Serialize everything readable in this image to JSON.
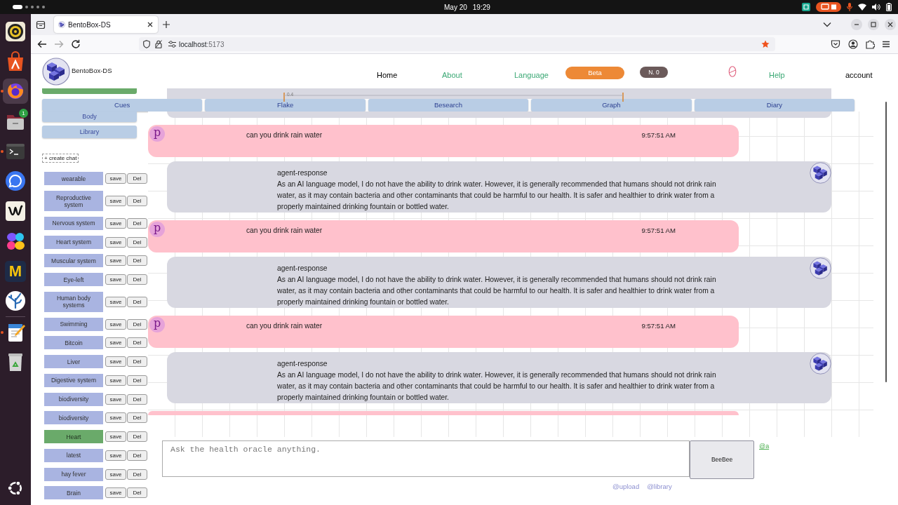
{
  "system_bar": {
    "date": "May 20",
    "time": "19:29"
  },
  "dock": [
    {
      "kind": "speaker",
      "running": false,
      "focused": false
    },
    {
      "kind": "bag",
      "running": false,
      "focused": false
    },
    {
      "kind": "browser",
      "running": true,
      "focused": true
    },
    {
      "kind": "folder",
      "running": false,
      "focused": false,
      "badge": "1"
    },
    {
      "kind": "terminal",
      "running": true,
      "focused": false
    },
    {
      "kind": "chat",
      "running": false,
      "focused": false
    },
    {
      "kind": "zigzag",
      "running": false,
      "focused": false
    },
    {
      "kind": "petals",
      "running": false,
      "focused": false
    },
    {
      "kind": "letter",
      "glyph": "M",
      "running": false,
      "focused": false
    },
    {
      "kind": "coral",
      "running": false,
      "focused": false
    },
    {
      "kind": "separator"
    },
    {
      "kind": "notepad",
      "running": true,
      "focused": false
    },
    {
      "kind": "trash",
      "running": false,
      "focused": false
    }
  ],
  "browser": {
    "tab_title": "BentoBox-DS",
    "url_host": "localhost",
    "url_port": ":5173",
    "bookmarked": true
  },
  "header": {
    "brand": "BentoBox-DS",
    "nav": [
      {
        "kind": "link",
        "label": "Home",
        "color": "#000000"
      },
      {
        "kind": "link",
        "label": "About",
        "color": "#3aa874"
      },
      {
        "kind": "link",
        "label": "Language",
        "color": "#3aa874"
      },
      {
        "kind": "button",
        "label": "Beta",
        "color": "#ed8936"
      },
      {
        "kind": "counter",
        "label": "N. 0",
        "color": "#6b5a5a"
      },
      {
        "kind": "icon"
      },
      {
        "kind": "link",
        "label": "Help",
        "color": "#3aa874"
      },
      {
        "kind": "link",
        "label": "account",
        "color": "#000000"
      }
    ]
  },
  "sidebar": {
    "buttons": [
      {
        "selected": true
      },
      {
        "label": "Body",
        "selected": false
      },
      {
        "label": "Library",
        "selected": false
      }
    ],
    "create_chat": "+ create chat",
    "chats": [
      {
        "title": "wearable",
        "selected": false,
        "save": "save",
        "delete": "Del"
      },
      {
        "title": "Reproductive system",
        "selected": false,
        "save": "save",
        "delete": "Del"
      },
      {
        "title": "Nervous system",
        "selected": false,
        "save": "save",
        "delete": "Del"
      },
      {
        "title": "Heart system",
        "selected": false,
        "save": "save",
        "delete": "Del"
      },
      {
        "title": "Muscular system",
        "selected": false,
        "save": "save",
        "delete": "Del"
      },
      {
        "title": "Eye-left",
        "selected": false,
        "save": "save",
        "delete": "Del"
      },
      {
        "title": "Human body systems",
        "selected": false,
        "save": "save",
        "delete": "Del"
      },
      {
        "title": "Swimming",
        "selected": false,
        "save": "save",
        "delete": "Del"
      },
      {
        "title": "Bitcoin",
        "selected": false,
        "save": "save",
        "delete": "Del"
      },
      {
        "title": "Liver",
        "selected": false,
        "save": "save",
        "delete": "Del"
      },
      {
        "title": "Digestive system",
        "selected": false,
        "save": "save",
        "delete": "Del"
      },
      {
        "title": "biodiversity",
        "selected": false,
        "save": "save",
        "delete": "Del"
      },
      {
        "title": "biodiversity",
        "selected": false,
        "save": "save",
        "delete": "Del"
      },
      {
        "title": "Heart",
        "selected": true,
        "save": "save",
        "delete": "Del"
      },
      {
        "title": "latest",
        "selected": false,
        "save": "save",
        "delete": "Del"
      },
      {
        "title": "hay fever",
        "selected": false,
        "save": "save",
        "delete": "Del"
      },
      {
        "title": "Brain",
        "selected": false,
        "save": "save",
        "delete": "Del"
      }
    ]
  },
  "scale": {
    "reading": "0.4"
  },
  "tabs": [
    {
      "label": "Cues",
      "selected": false
    },
    {
      "label": "Flake",
      "selected": false
    },
    {
      "label": "Besearch",
      "selected": false
    },
    {
      "label": "Graph",
      "selected": false
    },
    {
      "label": "Diary",
      "selected": false
    }
  ],
  "messages": [
    {
      "kind": "user",
      "avatar": "p",
      "text": "can you drink rain water",
      "time": "9:57:51 AM"
    },
    {
      "kind": "agent",
      "label": "agent-response",
      "text": "As an AI language model, I do not have the ability to drink water. However, it is generally recommended that humans should not drink rain water, as it may contain bacteria and other contaminants that could be harmful to our health. It is safer and healthier to drink water from a properly maintained drinking fountain or bottled water."
    },
    {
      "kind": "user",
      "avatar": "p",
      "text": "can you drink rain water",
      "time": "9:57:51 AM"
    },
    {
      "kind": "agent",
      "label": "agent-response",
      "text": "As an AI language model, I do not have the ability to drink water. However, it is generally recommended that humans should not drink rain water, as it may contain bacteria and other contaminants that could be harmful to our health. It is safer and healthier to drink water from a properly maintained drinking fountain or bottled water."
    },
    {
      "kind": "user",
      "avatar": "p",
      "text": "can you drink rain water",
      "time": "9:57:51 AM"
    },
    {
      "kind": "agent",
      "label": "agent-response",
      "text": "As an AI language model, I do not have the ability to drink water. However, it is generally recommended that humans should not drink rain water, as it may contain bacteria and other contaminants that could be harmful to our health. It is safer and healthier to drink water from a properly maintained drinking fountain or bottled water."
    },
    {
      "kind": "user"
    }
  ],
  "composer": {
    "placeholder": "Ask the health oracle anything.",
    "send": "BeeBee",
    "mention": "@a",
    "links": [
      "@upload",
      "@library"
    ]
  }
}
